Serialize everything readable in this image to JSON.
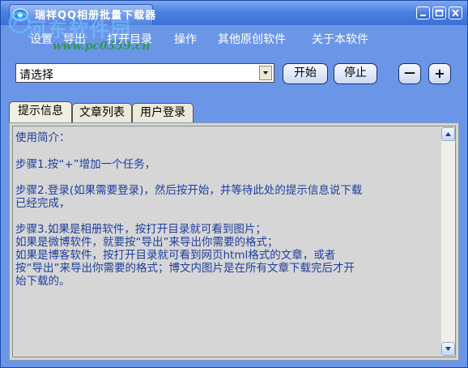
{
  "window": {
    "title": "瑞祥QQ相册批量下载器",
    "watermark_cn": "河东软件园",
    "watermark_url": "www.pc0359.cn"
  },
  "menu": [
    {
      "label": "设置"
    },
    {
      "label": "导出"
    },
    {
      "label": "打开目录"
    },
    {
      "label": "操作"
    },
    {
      "label": "其他原创软件"
    },
    {
      "label": "关于本软件"
    }
  ],
  "toolbar": {
    "select_value": "请选择",
    "start_label": "开始",
    "stop_label": "停止",
    "minus_label": "—",
    "plus_label": "+"
  },
  "tabs": [
    {
      "label": "提示信息",
      "active": true
    },
    {
      "label": "文章列表",
      "active": false
    },
    {
      "label": "用户登录",
      "active": false
    }
  ],
  "content": {
    "lines": [
      "使用简介：",
      "",
      "步骤1.按“+”增加一个任务，",
      "",
      "步骤2.登录(如果需要登录)，然后按开始，并等待此处的提示信息说下载",
      "已经完成，",
      "",
      "步骤3.如果是相册软件，按打开目录就可看到图片；",
      "        如果是微博软件，就要按“导出”来导出你需要的格式；",
      "        如果是博客软件，按打开目录就可看到网页html格式的文章，或者",
      "按“导出”来导出你需要的格式；博文内图片是在所有文章下载完后才开",
      "始下载的。"
    ]
  }
}
